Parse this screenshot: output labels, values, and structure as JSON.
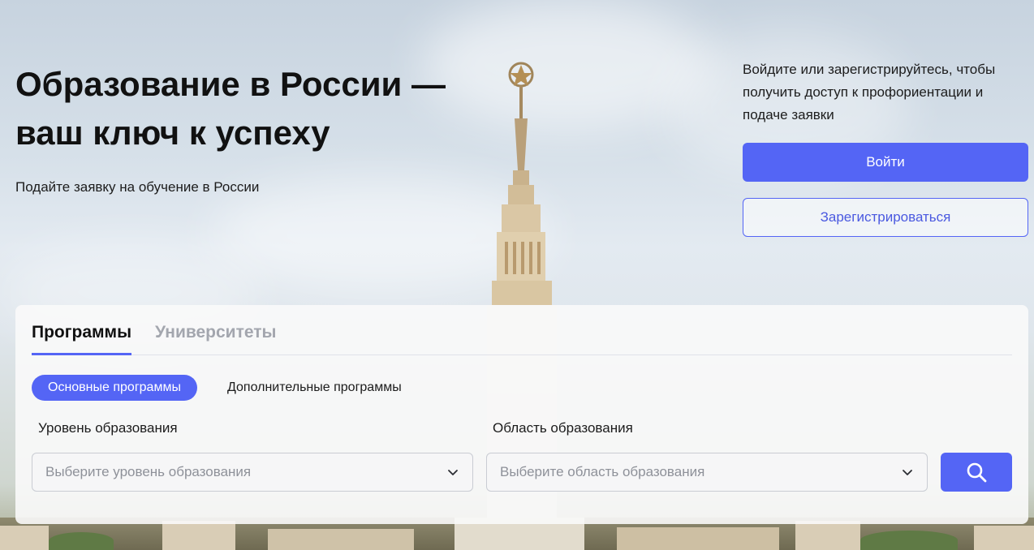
{
  "hero": {
    "title": "Образование в России — ваш ключ к успеху",
    "subtitle": "Подайте заявку на обучение в России",
    "background_icon": "moscow-university-tower-photo"
  },
  "auth": {
    "prompt": "Войдите или зарегистрируйтесь, чтобы получить доступ к профориентации и подаче заявки",
    "login_label": "Войти",
    "register_label": "Зарегистрироваться"
  },
  "search_panel": {
    "tabs": [
      {
        "label": "Программы",
        "active": true
      },
      {
        "label": "Университеты",
        "active": false
      }
    ],
    "program_types": [
      {
        "label": "Основные программы",
        "active": true
      },
      {
        "label": "Дополнительные программы",
        "active": false
      }
    ],
    "level": {
      "label": "Уровень образования",
      "placeholder": "Выберите уровень образования"
    },
    "area": {
      "label": "Область образования",
      "placeholder": "Выберите область образования"
    },
    "search_icon": "search-icon"
  },
  "colors": {
    "accent": "#5465f5",
    "text": "#1c1c1c",
    "muted": "#a3a6ae"
  }
}
